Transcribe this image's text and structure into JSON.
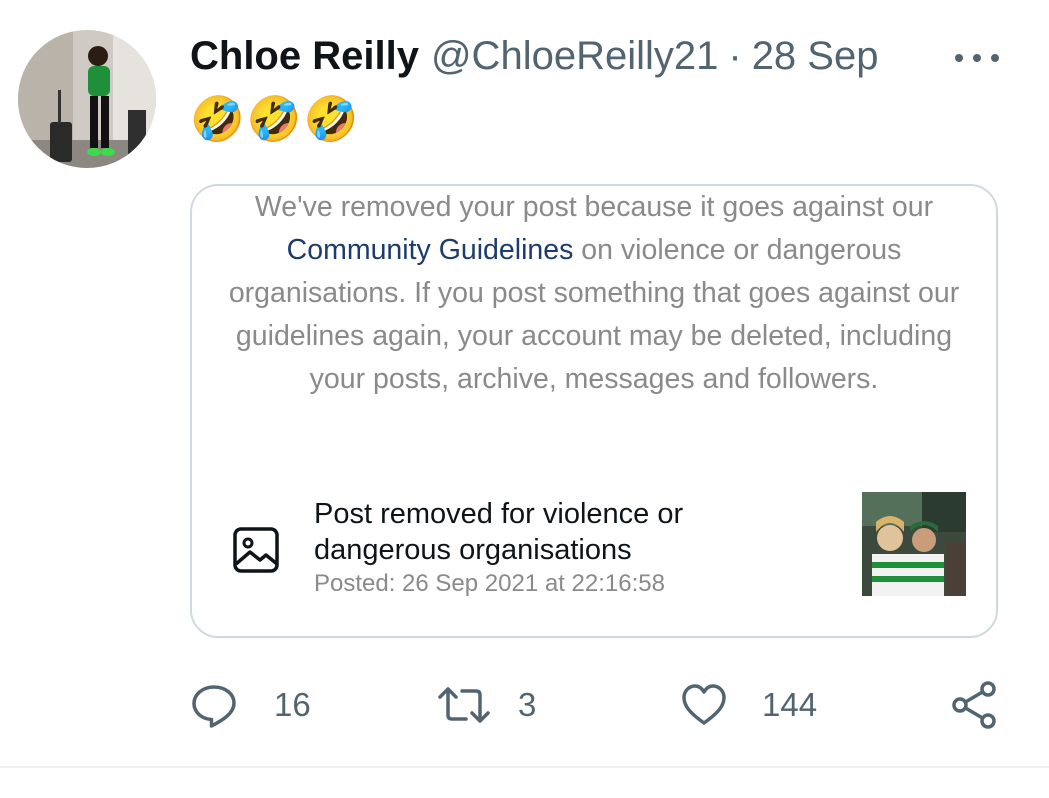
{
  "tweet": {
    "author_name": "Chloe Reilly",
    "author_handle": "@ChloeReilly21",
    "separator": "·",
    "date": "28 Sep",
    "text": "🤣🤣🤣",
    "avatar_icon": "profile-photo",
    "more_icon": "more-dots-icon"
  },
  "card": {
    "notice_part1": "We've removed your post because it goes against our ",
    "notice_link": "Community Guidelines",
    "notice_part2": " on violence or dangerous organisations. If you post something that goes against our guidelines again, your account may be deleted, including your posts, archive, messages and followers.",
    "removed_title_line1": "Post removed for violence or",
    "removed_title_line2": "dangerous organisations",
    "posted": "Posted: 26 Sep 2021 at 22:16:58",
    "image_icon": "image-icon",
    "link_color": "#1d3b6e"
  },
  "actions": {
    "replies": "16",
    "retweets": "3",
    "likes": "144",
    "reply_icon": "reply-icon",
    "retweet_icon": "retweet-icon",
    "like_icon": "heart-icon",
    "share_icon": "share-icon"
  }
}
